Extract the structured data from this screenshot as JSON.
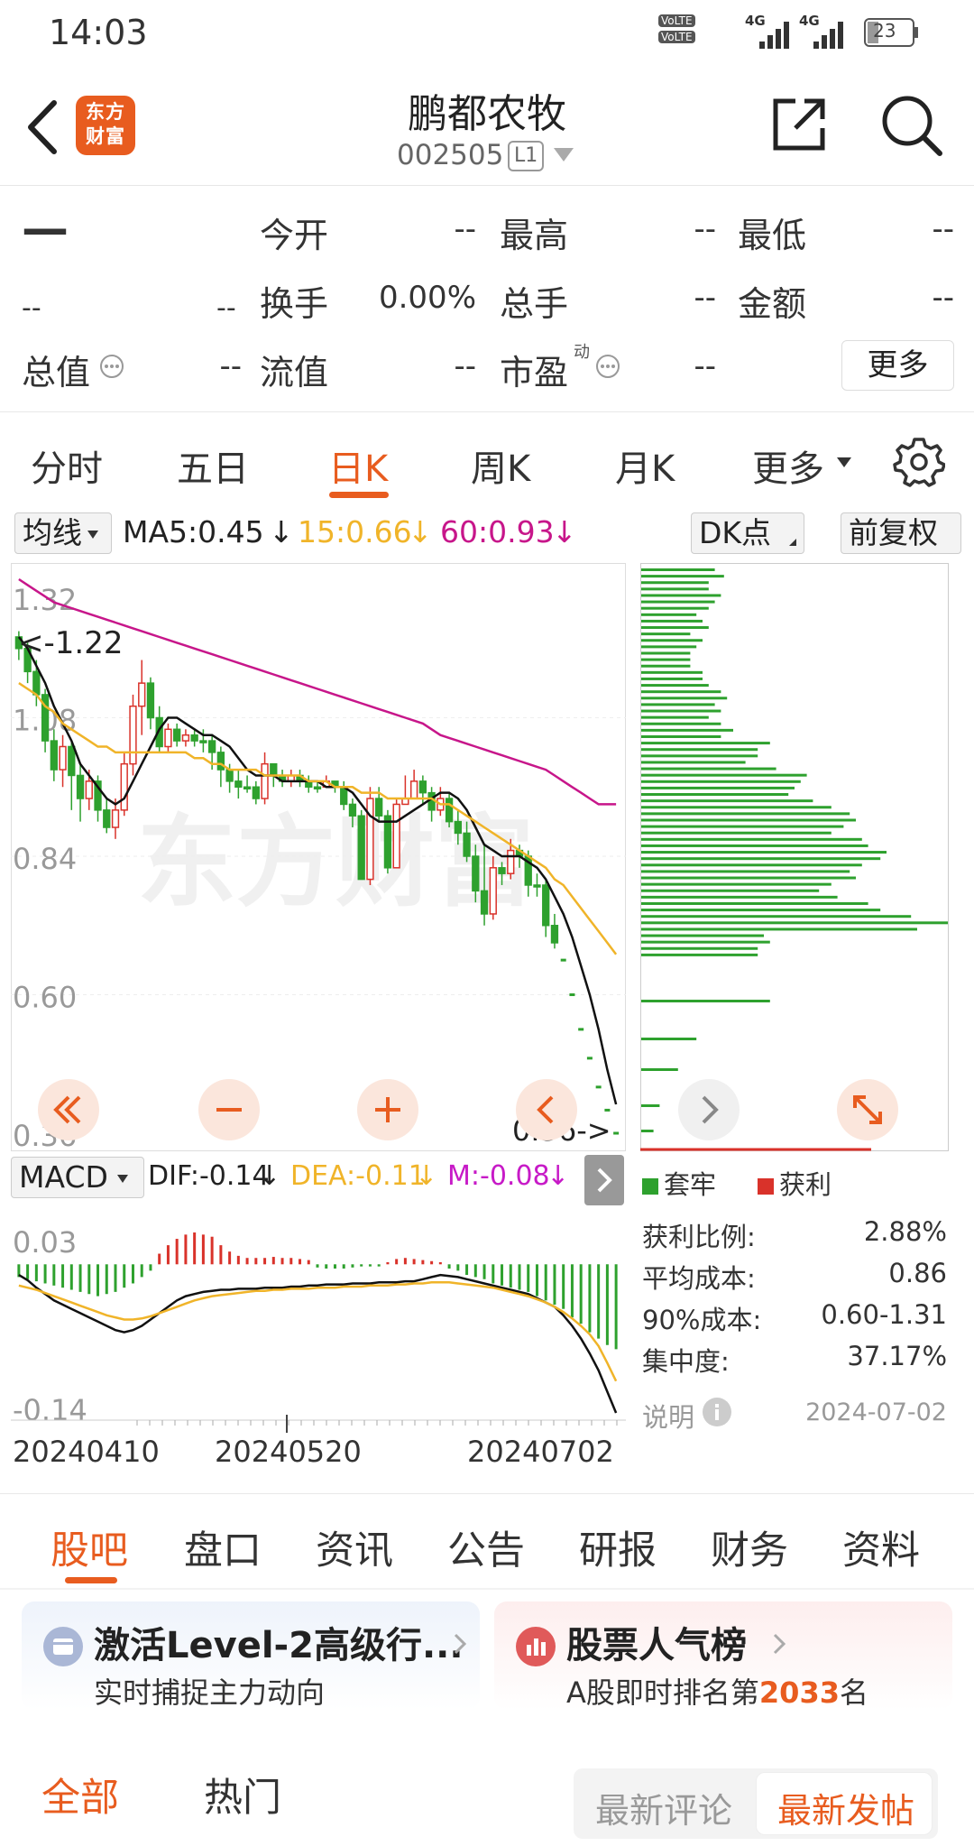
{
  "status": {
    "time": "14:03",
    "battery": "23",
    "net1": "4G",
    "net2": "4G",
    "volte": "VoLTE"
  },
  "header": {
    "title": "鹏都农牧",
    "code": "002505",
    "level": "L1",
    "logo_text": "东方财富"
  },
  "quote": {
    "price": "—",
    "change": "--",
    "change_pct": "--",
    "open_label": "今开",
    "open_value": "--",
    "high_label": "最高",
    "high_value": "--",
    "low_label": "最低",
    "low_value": "--",
    "turnover_label": "换手",
    "turnover_value": "0.00%",
    "volume_label": "总手",
    "volume_value": "--",
    "amount_label": "金额",
    "amount_value": "--",
    "mcap_label": "总值",
    "mcap_value": "--",
    "float_label": "流值",
    "float_value": "--",
    "pe_label": "市盈",
    "pe_sup": "动",
    "pe_value": "--",
    "more_label": "更多"
  },
  "periods": [
    "分时",
    "五日",
    "日K",
    "周K",
    "月K",
    "更多"
  ],
  "active_period": "日K",
  "ma": {
    "select": "均线",
    "ma5": "MA5:0.45",
    "ma15": "15:0.66",
    "ma60": "60:0.93",
    "arrow": "↓",
    "dk_label": "DK点",
    "fq_label": "前复权"
  },
  "colors": {
    "accent": "#e85c1f",
    "ma5": "#111111",
    "ma15": "#f0b429",
    "ma60": "#c7168a",
    "up": "#d9322a",
    "down": "#2ea12e"
  },
  "chart_data": [
    {
      "type": "candlestick",
      "y_ticks": [
        "1.32",
        "1.08",
        "0.84",
        "0.60",
        "0.36"
      ],
      "ylim": [
        0.36,
        1.32
      ],
      "annotations": {
        "high": "<-1.22",
        "low": "0.36->"
      },
      "watermark": "东方财富",
      "candles": [
        [
          1.22,
          1.2,
          1.23,
          1.18
        ],
        [
          1.2,
          1.16,
          1.21,
          1.14
        ],
        [
          1.16,
          1.12,
          1.18,
          1.1
        ],
        [
          1.12,
          1.04,
          1.13,
          1.02
        ],
        [
          1.04,
          0.99,
          1.06,
          0.97
        ],
        [
          0.99,
          1.03,
          1.05,
          0.96
        ],
        [
          1.03,
          0.98,
          1.04,
          0.92
        ],
        [
          0.98,
          0.94,
          1.0,
          0.9
        ],
        [
          0.94,
          0.97,
          0.99,
          0.92
        ],
        [
          0.97,
          0.92,
          0.98,
          0.9
        ],
        [
          0.92,
          0.89,
          0.94,
          0.88
        ],
        [
          0.89,
          0.92,
          0.94,
          0.87
        ],
        [
          0.92,
          1.0,
          1.02,
          0.91
        ],
        [
          1.0,
          1.1,
          1.12,
          0.98
        ],
        [
          1.1,
          1.14,
          1.18,
          1.05
        ],
        [
          1.14,
          1.08,
          1.15,
          1.06
        ],
        [
          1.08,
          1.03,
          1.1,
          1.02
        ],
        [
          1.03,
          1.06,
          1.07,
          1.02
        ],
        [
          1.06,
          1.04,
          1.07,
          1.03
        ],
        [
          1.04,
          1.05,
          1.06,
          1.03
        ],
        [
          1.05,
          1.04,
          1.06,
          1.03
        ],
        [
          1.04,
          1.04,
          1.06,
          1.02
        ],
        [
          1.04,
          1.02,
          1.05,
          0.99
        ],
        [
          1.02,
          0.99,
          1.03,
          0.96
        ],
        [
          0.99,
          0.97,
          1.0,
          0.95
        ],
        [
          0.97,
          0.96,
          0.99,
          0.94
        ],
        [
          0.96,
          0.96,
          0.98,
          0.95
        ],
        [
          0.96,
          0.94,
          0.97,
          0.93
        ],
        [
          0.94,
          1.0,
          1.02,
          0.93
        ],
        [
          1.0,
          0.98,
          1.0,
          0.96
        ],
        [
          0.98,
          0.97,
          0.99,
          0.96
        ],
        [
          0.97,
          0.98,
          0.99,
          0.96
        ],
        [
          0.98,
          0.97,
          0.99,
          0.96
        ],
        [
          0.97,
          0.96,
          0.98,
          0.95
        ],
        [
          0.96,
          0.96,
          0.97,
          0.95
        ],
        [
          0.96,
          0.97,
          0.98,
          0.96
        ],
        [
          0.97,
          0.96,
          0.97,
          0.95
        ],
        [
          0.96,
          0.93,
          0.97,
          0.92
        ],
        [
          0.93,
          0.91,
          0.94,
          0.89
        ],
        [
          0.91,
          0.8,
          0.92,
          0.8
        ],
        [
          0.8,
          0.94,
          0.96,
          0.79
        ],
        [
          0.94,
          0.91,
          0.96,
          0.9
        ],
        [
          0.91,
          0.82,
          0.92,
          0.81
        ],
        [
          0.82,
          0.93,
          0.94,
          0.82
        ],
        [
          0.93,
          0.94,
          0.98,
          0.93
        ],
        [
          0.94,
          0.97,
          0.99,
          0.94
        ],
        [
          0.97,
          0.95,
          0.98,
          0.93
        ],
        [
          0.95,
          0.92,
          0.96,
          0.9
        ],
        [
          0.92,
          0.94,
          0.96,
          0.91
        ],
        [
          0.94,
          0.9,
          0.95,
          0.89
        ],
        [
          0.9,
          0.88,
          0.92,
          0.86
        ],
        [
          0.88,
          0.84,
          0.9,
          0.83
        ],
        [
          0.84,
          0.78,
          0.86,
          0.76
        ],
        [
          0.78,
          0.74,
          0.86,
          0.72
        ],
        [
          0.74,
          0.82,
          0.84,
          0.73
        ],
        [
          0.82,
          0.81,
          0.83,
          0.79
        ],
        [
          0.81,
          0.85,
          0.87,
          0.8
        ],
        [
          0.85,
          0.84,
          0.86,
          0.82
        ],
        [
          0.84,
          0.79,
          0.85,
          0.77
        ],
        [
          0.79,
          0.79,
          0.81,
          0.77
        ],
        [
          0.79,
          0.72,
          0.8,
          0.7
        ],
        [
          0.72,
          0.69,
          0.74,
          0.68
        ],
        [
          0.66,
          0.66,
          0.66,
          0.66
        ],
        [
          0.6,
          0.6,
          0.6,
          0.6
        ],
        [
          0.54,
          0.54,
          0.54,
          0.54
        ],
        [
          0.49,
          0.49,
          0.49,
          0.49
        ],
        [
          0.44,
          0.44,
          0.44,
          0.44
        ],
        [
          0.4,
          0.4,
          0.4,
          0.4
        ],
        [
          0.36,
          0.36,
          0.36,
          0.36
        ]
      ],
      "ma5": [
        1.22,
        1.2,
        1.17,
        1.14,
        1.1,
        1.07,
        1.04,
        1.0,
        0.98,
        0.96,
        0.94,
        0.93,
        0.94,
        0.97,
        1.0,
        1.03,
        1.06,
        1.08,
        1.08,
        1.07,
        1.06,
        1.05,
        1.05,
        1.04,
        1.03,
        1.01,
        0.99,
        0.98,
        0.98,
        0.98,
        0.97,
        0.97,
        0.97,
        0.97,
        0.97,
        0.96,
        0.96,
        0.96,
        0.95,
        0.93,
        0.91,
        0.9,
        0.9,
        0.9,
        0.91,
        0.92,
        0.93,
        0.94,
        0.95,
        0.95,
        0.94,
        0.92,
        0.89,
        0.86,
        0.85,
        0.84,
        0.84,
        0.84,
        0.83,
        0.82,
        0.8,
        0.77,
        0.74,
        0.7,
        0.65,
        0.6,
        0.54,
        0.47,
        0.41
      ],
      "ma15": [
        1.14,
        1.13,
        1.12,
        1.1,
        1.09,
        1.07,
        1.06,
        1.05,
        1.04,
        1.03,
        1.03,
        1.02,
        1.02,
        1.02,
        1.02,
        1.02,
        1.02,
        1.02,
        1.02,
        1.02,
        1.01,
        1.01,
        1.0,
        1.0,
        0.99,
        0.99,
        0.99,
        0.99,
        0.98,
        0.98,
        0.98,
        0.98,
        0.98,
        0.97,
        0.97,
        0.97,
        0.96,
        0.96,
        0.96,
        0.95,
        0.95,
        0.95,
        0.94,
        0.94,
        0.94,
        0.94,
        0.94,
        0.94,
        0.93,
        0.93,
        0.92,
        0.91,
        0.9,
        0.89,
        0.88,
        0.87,
        0.86,
        0.85,
        0.84,
        0.83,
        0.82,
        0.8,
        0.79,
        0.77,
        0.75,
        0.73,
        0.71,
        0.69,
        0.67
      ],
      "ma60": [
        1.32,
        1.31,
        1.3,
        1.29,
        1.28,
        1.275,
        1.27,
        1.265,
        1.26,
        1.255,
        1.25,
        1.245,
        1.24,
        1.235,
        1.23,
        1.225,
        1.22,
        1.215,
        1.21,
        1.205,
        1.2,
        1.195,
        1.19,
        1.185,
        1.18,
        1.175,
        1.17,
        1.165,
        1.16,
        1.155,
        1.15,
        1.145,
        1.14,
        1.135,
        1.13,
        1.125,
        1.12,
        1.115,
        1.11,
        1.105,
        1.1,
        1.095,
        1.09,
        1.085,
        1.08,
        1.075,
        1.07,
        1.06,
        1.05,
        1.045,
        1.04,
        1.035,
        1.03,
        1.025,
        1.02,
        1.015,
        1.01,
        1.005,
        1.0,
        0.995,
        0.99,
        0.98,
        0.97,
        0.96,
        0.95,
        0.94,
        0.93,
        0.93,
        0.93
      ]
    },
    {
      "type": "bar",
      "name": "MACD",
      "y_ticks": [
        "0.03",
        "-0.14"
      ],
      "ylim": [
        -0.14,
        0.03
      ],
      "x_ticks": [
        "20240410",
        "20240520",
        "20240702"
      ],
      "dif_label": "DIF:-0.14",
      "dea_label": "DEA:-0.11",
      "m_label": "M:-0.08",
      "m": [
        -0.012,
        -0.014,
        -0.016,
        -0.018,
        -0.02,
        -0.022,
        -0.024,
        -0.026,
        -0.028,
        -0.03,
        -0.028,
        -0.026,
        -0.022,
        -0.018,
        -0.012,
        -0.006,
        0.01,
        0.018,
        0.024,
        0.028,
        0.03,
        0.028,
        0.026,
        0.018,
        0.012,
        0.008,
        0.006,
        0.006,
        0.006,
        0.007,
        0.006,
        0.006,
        0.005,
        0.004,
        -0.003,
        -0.004,
        -0.004,
        -0.004,
        -0.003,
        -0.002,
        -0.002,
        -0.002,
        0.002,
        0.005,
        0.006,
        0.005,
        0.004,
        0.003,
        0.002,
        -0.004,
        -0.006,
        -0.01,
        -0.012,
        -0.014,
        -0.018,
        -0.02,
        -0.022,
        -0.024,
        -0.026,
        -0.03,
        -0.034,
        -0.038,
        -0.042,
        -0.05,
        -0.056,
        -0.064,
        -0.07,
        -0.076,
        -0.08
      ],
      "dif": [
        -0.01,
        -0.015,
        -0.022,
        -0.028,
        -0.034,
        -0.038,
        -0.042,
        -0.046,
        -0.05,
        -0.054,
        -0.058,
        -0.062,
        -0.064,
        -0.062,
        -0.058,
        -0.052,
        -0.046,
        -0.04,
        -0.034,
        -0.03,
        -0.028,
        -0.026,
        -0.025,
        -0.024,
        -0.024,
        -0.023,
        -0.023,
        -0.023,
        -0.022,
        -0.022,
        -0.022,
        -0.021,
        -0.021,
        -0.02,
        -0.02,
        -0.019,
        -0.019,
        -0.019,
        -0.018,
        -0.018,
        -0.018,
        -0.017,
        -0.017,
        -0.017,
        -0.016,
        -0.016,
        -0.014,
        -0.012,
        -0.01,
        -0.011,
        -0.012,
        -0.014,
        -0.016,
        -0.018,
        -0.02,
        -0.022,
        -0.024,
        -0.026,
        -0.028,
        -0.032,
        -0.036,
        -0.04,
        -0.048,
        -0.058,
        -0.07,
        -0.084,
        -0.1,
        -0.12,
        -0.14
      ],
      "dea": [
        -0.02,
        -0.022,
        -0.024,
        -0.027,
        -0.03,
        -0.033,
        -0.036,
        -0.039,
        -0.042,
        -0.045,
        -0.048,
        -0.05,
        -0.052,
        -0.052,
        -0.051,
        -0.049,
        -0.046,
        -0.043,
        -0.04,
        -0.037,
        -0.034,
        -0.032,
        -0.03,
        -0.029,
        -0.028,
        -0.027,
        -0.026,
        -0.025,
        -0.025,
        -0.024,
        -0.024,
        -0.023,
        -0.023,
        -0.023,
        -0.022,
        -0.022,
        -0.022,
        -0.021,
        -0.021,
        -0.021,
        -0.02,
        -0.02,
        -0.02,
        -0.019,
        -0.019,
        -0.018,
        -0.018,
        -0.017,
        -0.017,
        -0.017,
        -0.018,
        -0.019,
        -0.02,
        -0.021,
        -0.022,
        -0.024,
        -0.026,
        -0.028,
        -0.03,
        -0.033,
        -0.036,
        -0.04,
        -0.045,
        -0.051,
        -0.058,
        -0.066,
        -0.077,
        -0.093,
        -0.11
      ]
    },
    {
      "type": "bar",
      "name": "chip-distribution",
      "legend": [
        "套牢",
        "获利"
      ],
      "bars_green": [
        0.24,
        0.27,
        0.22,
        0.22,
        0.26,
        0.24,
        0.22,
        0.18,
        0.2,
        0.22,
        0.16,
        0.2,
        0.18,
        0.16,
        0.16,
        0.16,
        0.2,
        0.2,
        0.22,
        0.26,
        0.28,
        0.24,
        0.26,
        0.22,
        0.26,
        0.3,
        0.26,
        0.42,
        0.38,
        0.38,
        0.34,
        0.44,
        0.54,
        0.52,
        0.5,
        0.48,
        0.56,
        0.62,
        0.68,
        0.7,
        0.66,
        0.62,
        0.72,
        0.74,
        0.8,
        0.78,
        0.72,
        0.68,
        0.7,
        0.62,
        0.58,
        0.64,
        0.74,
        0.78,
        0.88,
        1.0,
        0.9,
        0.4,
        0.42,
        0.38,
        0.38
      ],
      "scatter": [
        [
          0.74,
          0.18
        ],
        [
          0.78,
          0.06
        ],
        [
          0.82,
          0.08
        ]
      ]
    }
  ],
  "macd_select": "MACD",
  "chips": {
    "legend_lock": "套牢",
    "legend_profit": "获利",
    "stats": [
      {
        "label": "获利比例:",
        "value": "2.88%"
      },
      {
        "label": "平均成本:",
        "value": "0.86"
      },
      {
        "label": "90%成本:",
        "value": "0.60-1.31"
      },
      {
        "label": "集中度:",
        "value": "37.17%"
      }
    ],
    "note_label": "说明",
    "date": "2024-07-02"
  },
  "bottom_tabs": [
    "股吧",
    "盘口",
    "资讯",
    "公告",
    "研报",
    "财务",
    "资料"
  ],
  "cards": {
    "level2_title": "激活Level-2高级行...",
    "level2_sub": "实时捕捉主力动向",
    "rank_title": "股票人气榜",
    "rank_prefix": "A股即时排名第",
    "rank_num": "2033",
    "rank_suffix": "名"
  },
  "feed": {
    "tab_all": "全部",
    "tab_hot": "热门",
    "latest_comment": "最新评论",
    "latest_post": "最新发帖"
  }
}
